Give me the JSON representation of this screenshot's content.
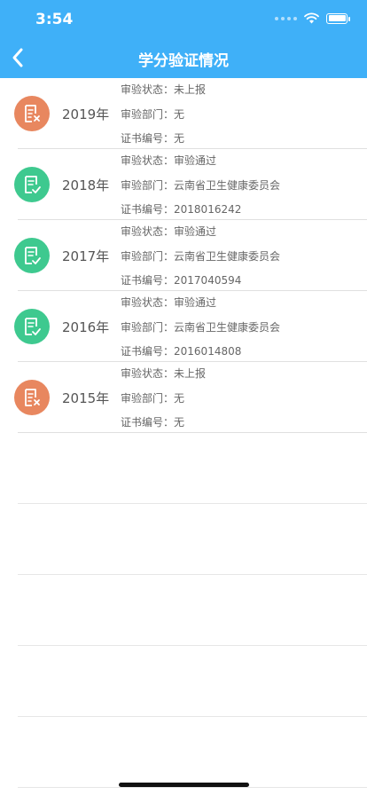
{
  "status_bar": {
    "time": "3:54"
  },
  "nav": {
    "title": "学分验证情况"
  },
  "colors": {
    "header": "#3fb0f8",
    "rejected": "#e8875f",
    "passed": "#3ec98f"
  },
  "records": [
    {
      "year": "2019年",
      "status_label": "审验状态：",
      "status": "未上报",
      "dept_label": "审验部门：",
      "dept": "无",
      "cert_label": "证书编号：",
      "cert": "无",
      "icon": "doc-x-icon",
      "state": "rejected"
    },
    {
      "year": "2018年",
      "status_label": "审验状态：",
      "status": "审验通过",
      "dept_label": "审验部门：",
      "dept": "云南省卫生健康委员会",
      "cert_label": "证书编号：",
      "cert": "2018016242",
      "icon": "doc-check-icon",
      "state": "passed"
    },
    {
      "year": "2017年",
      "status_label": "审验状态：",
      "status": "审验通过",
      "dept_label": "审验部门：",
      "dept": "云南省卫生健康委员会",
      "cert_label": "证书编号：",
      "cert": "2017040594",
      "icon": "doc-check-icon",
      "state": "passed"
    },
    {
      "year": "2016年",
      "status_label": "审验状态：",
      "status": "审验通过",
      "dept_label": "审验部门：",
      "dept": "云南省卫生健康委员会",
      "cert_label": "证书编号：",
      "cert": "2016014808",
      "icon": "doc-check-icon",
      "state": "passed"
    },
    {
      "year": "2015年",
      "status_label": "审验状态：",
      "status": "未上报",
      "dept_label": "审验部门：",
      "dept": "无",
      "cert_label": "证书编号：",
      "cert": "无",
      "icon": "doc-x-icon",
      "state": "rejected"
    }
  ]
}
